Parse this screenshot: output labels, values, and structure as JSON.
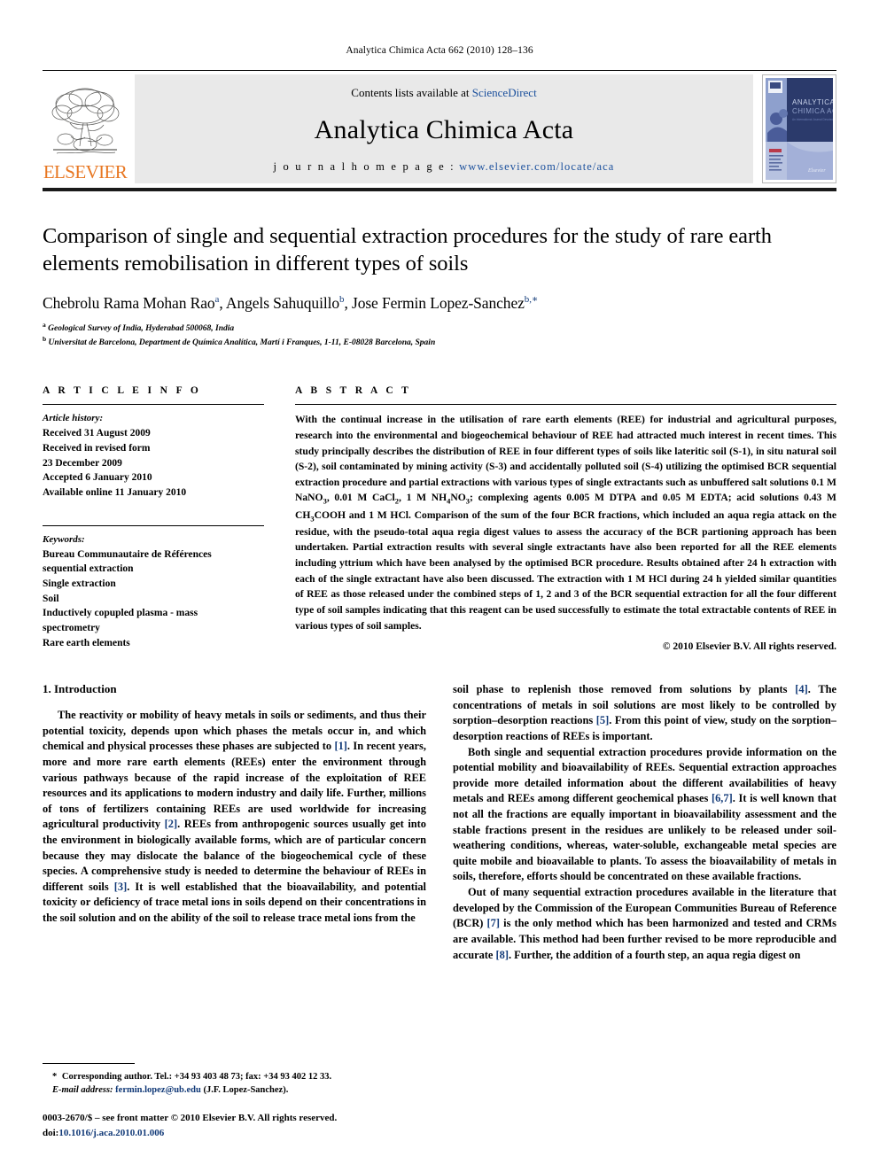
{
  "running_head": "Analytica Chimica Acta 662 (2010) 128–136",
  "masthead": {
    "contents_prefix": "Contents lists available at ",
    "contents_link": "ScienceDirect",
    "journal_name": "Analytica Chimica Acta",
    "homepage_label": "j o u r n a l   h o m e p a g e :",
    "homepage_url": "www.elsevier.com/locate/aca",
    "publisher_wordmark": "ELSEVIER",
    "cover_title_line1": "ANALYTICA",
    "cover_title_line2": "CHIMICA ACTA",
    "accent_orange": "#E87722",
    "link_blue": "#1a4f9c"
  },
  "article": {
    "title": "Comparison of single and sequential extraction procedures for the study of rare earth elements remobilisation in different types of soils",
    "authors_html": "Chebrolu Rama Mohan Rao<sup>a</sup>, Angels Sahuquillo<sup>b</sup>, Jose Fermin Lopez-Sanchez<sup>b,∗</sup>",
    "affiliations": [
      "Geological Survey of India, Hyderabad 500068, India",
      "Universitat de Barcelona, Department de Química Analítica, Martí i Franques, 1-11, E-08028 Barcelona, Spain"
    ],
    "affiliation_marks": [
      "a",
      "b"
    ]
  },
  "article_info": {
    "heading": "A R T I C L E   I N F O",
    "history_label": "Article history:",
    "history_lines": [
      "Received 31 August 2009",
      "Received in revised form",
      "23 December 2009",
      "Accepted 6 January 2010",
      "Available online 11 January 2010"
    ],
    "keywords_label": "Keywords:",
    "keywords": [
      "Bureau Communautaire de Références",
      "sequential extraction",
      "Single extraction",
      "Soil",
      "Inductively copupled plasma - mass",
      "spectrometry",
      "Rare earth elements"
    ]
  },
  "abstract": {
    "heading": "A B S T R A C T",
    "paragraph_html": "With the continual increase in the utilisation of rare earth elements (REE) for industrial and agricultural purposes, research into the environmental and biogeochemical behaviour of REE had attracted much interest in recent times. This study principally describes the distribution of REE in four different types of soils like lateritic soil (S-1), in situ natural soil (S-2), soil contaminated by mining activity (S-3) and accidentally polluted soil (S-4) utilizing the optimised BCR sequential extraction procedure and partial extractions with various types of single extractants such as unbuffered salt solutions 0.1 M NaNO<sub>3</sub>, 0.01 M CaCl<sub>2</sub>, 1 M NH<sub>4</sub>NO<sub>3</sub>; complexing agents 0.005 M DTPA and 0.05 M EDTA; acid solutions 0.43 M CH<sub>3</sub>COOH and 1 M HCl. Comparison of the sum of the four BCR fractions, which included an aqua regia attack on the residue, with the pseudo-total aqua regia digest values to assess the accuracy of the BCR partioning approach has been undertaken. Partial extraction results with several single extractants have also been reported for all the REE elements including yttrium which have been analysed by the optimised BCR procedure. Results obtained after 24 h extraction with each of the single extractant have also been discussed. The extraction with 1 M HCl during 24 h yielded similar quantities of REE as those released under the combined steps of 1, 2 and 3 of the BCR sequential extraction for all the four different type of soil samples indicating that this reagent can be used successfully to estimate the total extractable contents of REE in various types of soil samples.",
    "copyright": "© 2010 Elsevier B.V. All rights reserved."
  },
  "introduction": {
    "heading": "1.  Introduction",
    "left_paragraphs_html": [
      "The reactivity or mobility of heavy metals in soils or sediments, and thus their potential toxicity, depends upon which phases the metals occur in, and which chemical and physical processes these phases are subjected to <span class=\"ref\">[1]</span>. In recent years, more and more rare earth elements (REEs) enter the environment through various pathways because of the rapid increase of the exploitation of REE resources and its applications to modern industry and daily life. Further, millions of tons of fertilizers containing REEs are used worldwide for increasing agricultural productivity <span class=\"ref\">[2]</span>. REEs from anthropogenic sources usually get into the environment in biologically available forms, which are of particular concern because they may dislocate the balance of the biogeochemical cycle of these species. A comprehensive study is needed to determine the behaviour of REEs in different soils <span class=\"ref\">[3]</span>. It is well established that the bioavailability, and potential toxicity or deficiency of trace metal ions in soils depend on their concentrations in the soil solution and on the ability of the soil to release trace metal ions from the"
    ],
    "right_paragraphs_html": [
      "soil phase to replenish those removed from solutions by plants <span class=\"ref\">[4]</span>. The concentrations of metals in soil solutions are most likely to be controlled by sorption–desorption reactions <span class=\"ref\">[5]</span>. From this point of view, study on the sorption–desorption reactions of REEs is important.",
      "Both single and sequential extraction procedures provide information on the potential mobility and bioavailability of REEs. Sequential extraction approaches provide more detailed information about the different availabilities of heavy metals and REEs among different geochemical phases <span class=\"ref\">[6,7]</span>. It is well known that not all the fractions are equally important in bioavailability assessment and the stable fractions present in the residues are unlikely to be released under soil-weathering conditions, whereas, water-soluble, exchangeable metal species are quite mobile and bioavailable to plants. To assess the bioavailability of metals in soils, therefore, efforts should be concentrated on these available fractions.",
      "Out of many sequential extraction procedures available in the literature that developed by the Commission of the European Communities Bureau of Reference (BCR) <span class=\"ref\">[7]</span> is the only method which has been harmonized and tested and CRMs are available. This method had been further revised to be more reproducible and accurate <span class=\"ref\">[8]</span>. Further, the addition of a fourth step, an aqua regia digest on"
    ]
  },
  "footnote": {
    "corresponding_html": "<span class=\"star\">*</span> Corresponding author. Tel.: +34 93 403 48 73; fax: +34 93 402 12 33.",
    "email_label": "E-mail address:",
    "email": "fermin.lopez@ub.edu",
    "email_suffix": "(J.F. Lopez-Sanchez).",
    "issn_line": "0003-2670/$ – see front matter © 2010 Elsevier B.V. All rights reserved.",
    "doi_label": "doi:",
    "doi_value": "10.1016/j.aca.2010.01.006"
  }
}
